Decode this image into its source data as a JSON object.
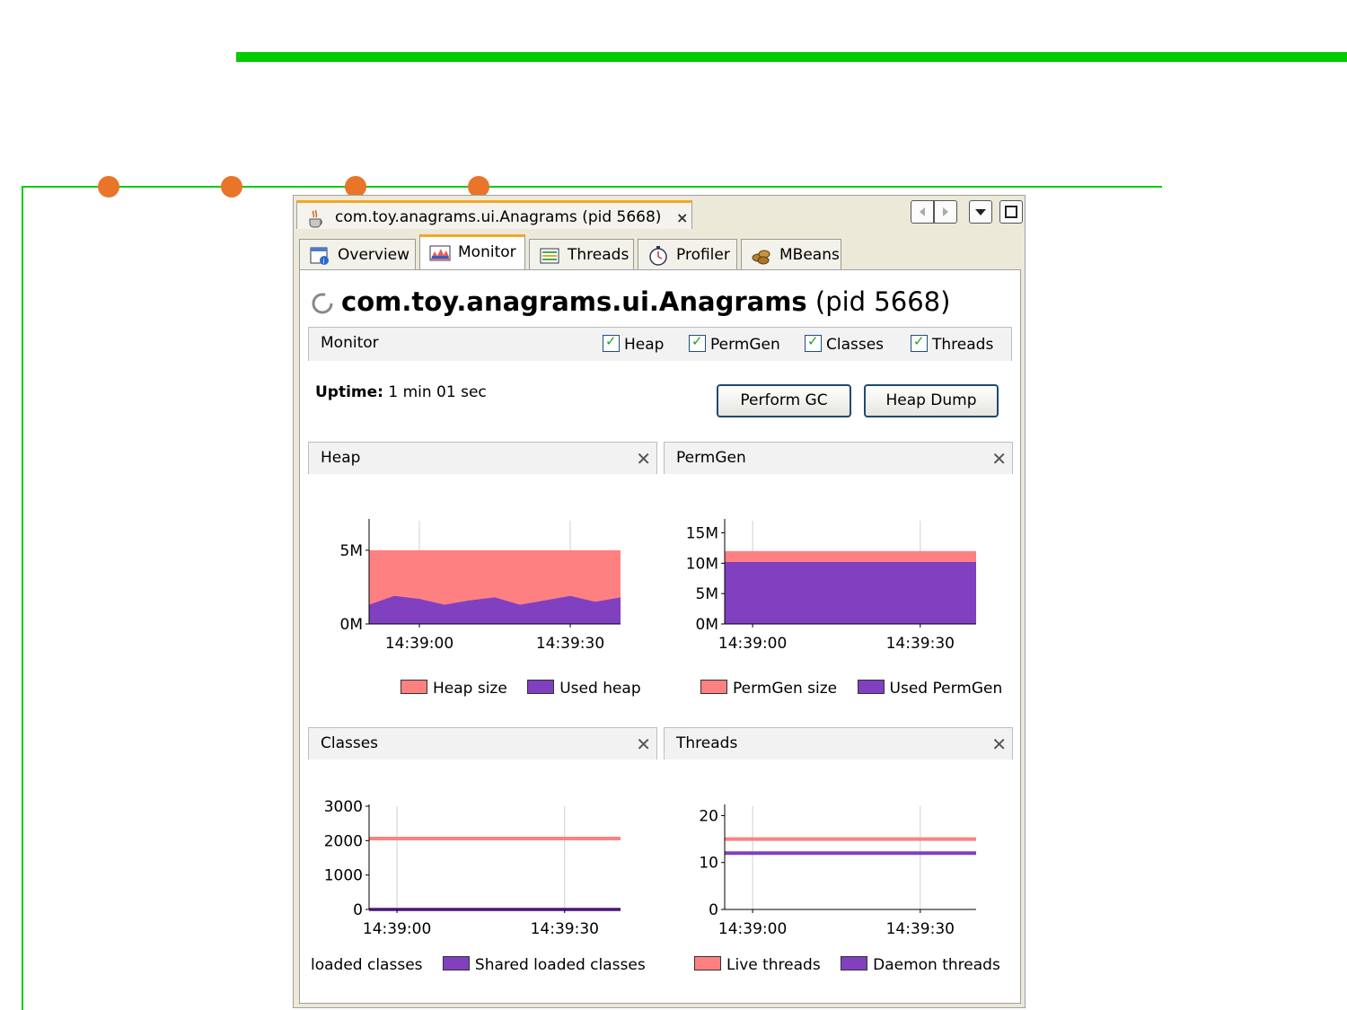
{
  "colors": {
    "accent_green": "#00cc00",
    "bullet_orange": "#e8752a",
    "tab_accent": "#f5a623",
    "series_red": "#ff8080",
    "series_purple": "#8040c0"
  },
  "window": {
    "doc_tab_title": "com.toy.anagrams.ui.Anagrams (pid 5668)",
    "close_glyph": "×",
    "app_icon": "java-cup-icon"
  },
  "tabs": [
    {
      "label": "Overview",
      "icon": "overview-icon"
    },
    {
      "label": "Monitor",
      "icon": "monitor-icon",
      "active": true
    },
    {
      "label": "Threads",
      "icon": "threads-icon"
    },
    {
      "label": "Profiler",
      "icon": "profiler-icon"
    },
    {
      "label": "MBeans",
      "icon": "mbeans-icon"
    }
  ],
  "header": {
    "app_name": "com.toy.anagrams.ui.Anagrams",
    "pid": "(pid 5668)"
  },
  "monitor_bar": {
    "label": "Monitor",
    "checkboxes": [
      {
        "label": "Heap",
        "checked": true
      },
      {
        "label": "PermGen",
        "checked": true
      },
      {
        "label": "Classes",
        "checked": true
      },
      {
        "label": "Threads",
        "checked": true
      }
    ]
  },
  "uptime": {
    "label": "Uptime:",
    "value": "1 min 01 sec"
  },
  "buttons": {
    "perform_gc": "Perform GC",
    "heap_dump": "Heap Dump"
  },
  "chart_data": [
    {
      "type": "area",
      "title": "Heap",
      "x": [
        "14:38:50",
        "14:38:55",
        "14:39:00",
        "14:39:05",
        "14:39:10",
        "14:39:15",
        "14:39:20",
        "14:39:25",
        "14:39:30",
        "14:39:35",
        "14:39:40"
      ],
      "xticks": [
        "14:39:00",
        "14:39:30"
      ],
      "yticks": [
        "0M",
        "5M"
      ],
      "ylim": [
        0,
        7
      ],
      "series": [
        {
          "name": "Heap size",
          "values": [
            5,
            5,
            5,
            5,
            5,
            5,
            5,
            5,
            5,
            5,
            5
          ]
        },
        {
          "name": "Used heap",
          "values": [
            1.3,
            1.9,
            1.7,
            1.3,
            1.6,
            1.8,
            1.3,
            1.6,
            1.9,
            1.5,
            1.8
          ]
        }
      ]
    },
    {
      "type": "area",
      "title": "PermGen",
      "x": [
        "14:38:55",
        "14:39:40"
      ],
      "xticks": [
        "14:39:00",
        "14:39:30"
      ],
      "yticks": [
        "0M",
        "5M",
        "10M",
        "15M"
      ],
      "ylim": [
        0,
        17
      ],
      "series": [
        {
          "name": "PermGen size",
          "values": [
            12,
            12
          ]
        },
        {
          "name": "Used PermGen",
          "values": [
            10.2,
            10.2
          ]
        }
      ]
    },
    {
      "type": "line",
      "title": "Classes",
      "x": [
        "14:38:55",
        "14:39:40"
      ],
      "xticks": [
        "14:39:00",
        "14:39:30"
      ],
      "yticks": [
        "0",
        "1000",
        "2000",
        "3000"
      ],
      "ylim": [
        0,
        3000
      ],
      "series": [
        {
          "name": "loaded classes",
          "values": [
            2060,
            2060
          ]
        },
        {
          "name": "Shared loaded classes",
          "values": [
            0,
            0
          ]
        }
      ]
    },
    {
      "type": "line",
      "title": "Threads",
      "x": [
        "14:38:55",
        "14:39:40"
      ],
      "xticks": [
        "14:39:00",
        "14:39:30"
      ],
      "yticks": [
        "0",
        "10",
        "20"
      ],
      "ylim": [
        0,
        22
      ],
      "series": [
        {
          "name": "Live threads",
          "values": [
            15,
            15
          ]
        },
        {
          "name": "Daemon threads",
          "values": [
            12,
            12
          ]
        }
      ]
    }
  ]
}
